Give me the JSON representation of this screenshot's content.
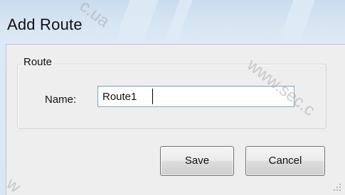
{
  "dialog": {
    "title": "Add Route"
  },
  "group": {
    "legend": "Route",
    "name_label": "Name:",
    "name_value": "Route1"
  },
  "buttons": {
    "save_label": "Save",
    "cancel_label": "Cancel"
  },
  "watermark": {
    "text_top": "c.ua",
    "text_right": "www.sec.c",
    "text_bottom": "w"
  },
  "colors": {
    "title_bar": "#d7e5f3",
    "client_bg": "#eeeeee",
    "input_border": "#7aa7d6"
  }
}
